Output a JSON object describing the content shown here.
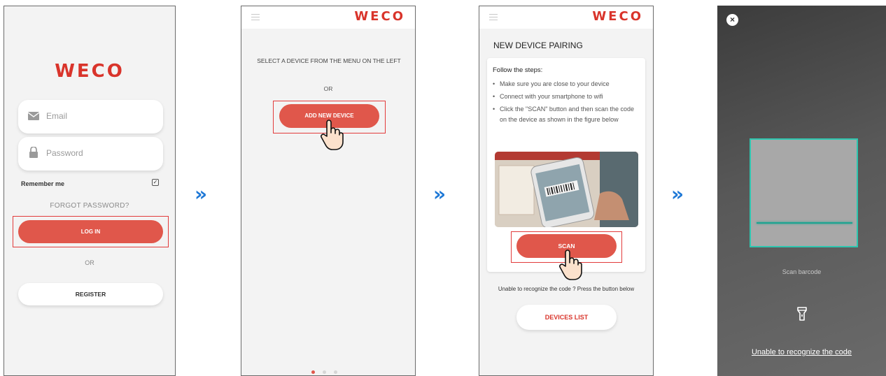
{
  "brand": {
    "logo": "WECO",
    "accent": "#e0574b",
    "arrow_color": "#1e78d6",
    "scan_color": "#2ec7b0"
  },
  "arrows": [
    "»",
    "»",
    "»"
  ],
  "login": {
    "email_placeholder": "Email",
    "password_placeholder": "Password",
    "remember_me": "Remember me",
    "forgot_password": "FORGOT PASSWORD?",
    "login_button": "LOG IN",
    "or": "OR",
    "register_button": "REGISTER"
  },
  "home": {
    "select_text": "SELECT A DEVICE FROM THE MENU ON THE LEFT",
    "or": "OR",
    "add_button": "ADD NEW DEVICE"
  },
  "pairing": {
    "title": "NEW DEVICE PAIRING",
    "steps_title": "Follow the steps:",
    "steps": [
      "Make sure you are close to your device",
      "Connect with your smartphone to wifi",
      "Click the \"SCAN\" button and then scan the code on the device as shown in the figure below"
    ],
    "scan_button": "SCAN",
    "unable_text": "Unable to recognize the code ? Press the button below",
    "devices_list_button": "DEVICES LIST"
  },
  "scanner": {
    "close": "×",
    "scan_label": "Scan barcode",
    "unable_link": "Unable to recognize the code"
  },
  "icons": [
    "email-icon",
    "lock-icon",
    "checkbox-icon",
    "hamburger-menu-icon",
    "hand-pointer-icon",
    "close-icon",
    "flashlight-icon"
  ]
}
